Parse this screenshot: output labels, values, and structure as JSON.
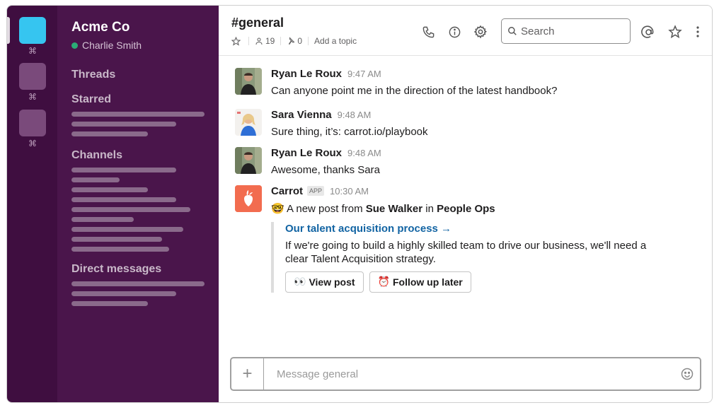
{
  "workspace": {
    "switcher": [
      {
        "key": "⌘",
        "color": "#36c5f0"
      },
      {
        "key": "⌘",
        "color": "#7a4a7b"
      },
      {
        "key": "⌘",
        "color": "#7a4a7b"
      }
    ]
  },
  "sidebar": {
    "team_name": "Acme Co",
    "user_name": "Charlie Smith",
    "presence_color": "#2bac76",
    "sections": {
      "threads": "Threads",
      "starred": "Starred",
      "channels": "Channels",
      "direct_messages": "Direct messages"
    }
  },
  "header": {
    "channel_name": "#general",
    "member_count": "19",
    "pinned_count": "0",
    "add_topic": "Add a topic",
    "search_placeholder": "Search",
    "icons": [
      "star-icon",
      "members-icon",
      "pin-icon",
      "phone-icon",
      "info-icon",
      "gear-icon",
      "search-icon",
      "mention-icon",
      "star-icon",
      "more-icon"
    ]
  },
  "messages": [
    {
      "author": "Ryan Le Roux",
      "time": "9:47 AM",
      "text": "Can anyone point me in the direction of the latest handbook?"
    },
    {
      "author": "Sara Vienna",
      "time": "9:48 AM",
      "text": "Sure thing, it’s: carrot.io/playbook"
    },
    {
      "author": "Ryan Le Roux",
      "time": "9:48 AM",
      "text": "Awesome, thanks Sara"
    },
    {
      "author": "Carrot",
      "badge": "APP",
      "time": "10:30 AM",
      "emoji": "🤓",
      "text_prefix": "A new post from",
      "text_author": "Sue Walker",
      "text_in": "in",
      "text_channel": "People Ops",
      "attachment": {
        "title": "Our talent acquisition process →",
        "body": "If we're going to build a highly skilled team to drive our business, we'll need a clear Talent Acquisition strategy.",
        "buttons": [
          {
            "emoji": "👀",
            "label": "View post"
          },
          {
            "emoji": "⏰",
            "label": "Follow up later"
          }
        ]
      }
    }
  ],
  "composer": {
    "plus": "+",
    "placeholder": "Message general"
  },
  "colors": {
    "rail": "#3f0e40",
    "sidebar": "#4a154b",
    "link": "#1264a3",
    "carrot_brand": "#f26c4f"
  }
}
